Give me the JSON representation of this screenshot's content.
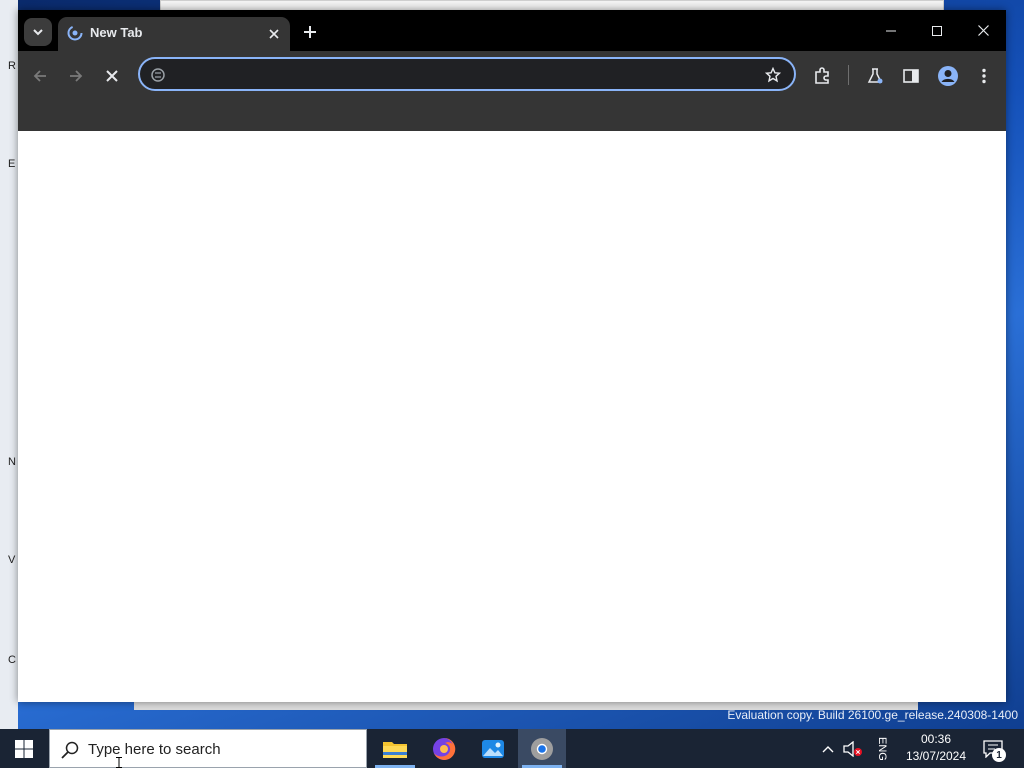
{
  "browser": {
    "tab": {
      "title": "New Tab"
    },
    "omnibox": {
      "value": "",
      "placeholder": ""
    },
    "icons": {
      "tab_list": "chevron-down-icon",
      "favicon": "chrome-loading-icon",
      "close_tab": "close-icon",
      "new_tab": "plus-icon",
      "minimize": "minimize-icon",
      "maximize": "maximize-icon",
      "close_window": "close-icon",
      "back": "arrow-left-icon",
      "forward": "arrow-right-icon",
      "stop": "stop-icon",
      "site_info": "site-info-icon",
      "bookmark": "star-icon",
      "extensions": "puzzle-icon",
      "labs": "flask-icon",
      "side_panel": "side-panel-icon",
      "profile": "profile-icon",
      "menu": "kebab-menu-icon"
    }
  },
  "taskbar": {
    "search_placeholder": "Type here to search",
    "apps": [
      {
        "name": "File Explorer",
        "icon": "folder-icon"
      },
      {
        "name": "Firefox",
        "icon": "firefox-icon"
      },
      {
        "name": "Photos",
        "icon": "photos-icon"
      },
      {
        "name": "Chrome",
        "icon": "chrome-icon",
        "active": true
      }
    ],
    "tray": {
      "language": "ENG",
      "time": "00:36",
      "date": "13/07/2024",
      "notification_count": "1"
    }
  },
  "desktop": {
    "watermark": "Evaluation copy. Build 26100.ge_release.240308-1400"
  },
  "colors": {
    "tabstrip": "#000000",
    "toolbar": "#353535",
    "omnibox_focus": "#8ab4f8",
    "taskbar": "#1a2434"
  }
}
